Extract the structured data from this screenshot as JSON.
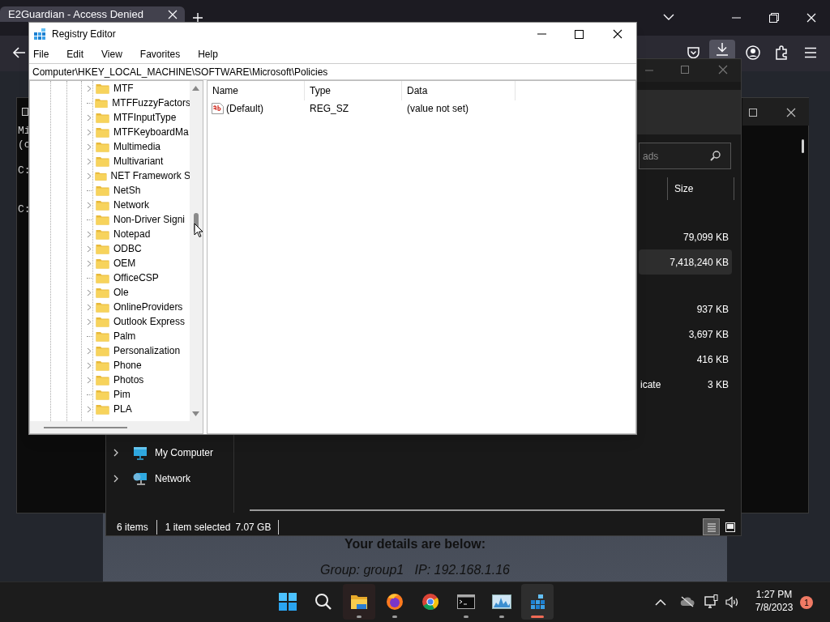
{
  "browser": {
    "tabs": [
      {
        "title": "E2Guardian - Access Denied",
        "selected": true
      }
    ],
    "page": {
      "heading": "Your details are below:",
      "details": "Group: group1   IP: 192.168.1.16"
    }
  },
  "terminal": {
    "lines": [
      "Mi",
      "(c",
      "C:",
      "C:"
    ]
  },
  "explorer": {
    "search": {
      "placeholder": "ads"
    },
    "columns": [
      "Size"
    ],
    "rows": [
      {
        "size": "79,099 KB",
        "selected": false
      },
      {
        "size": "7,418,240 KB",
        "selected": true
      },
      {
        "size": "937 KB",
        "selected": false
      },
      {
        "size": "3,697 KB",
        "selected": false
      },
      {
        "size": "416 KB",
        "selected": false
      },
      {
        "name": "icate",
        "size": "3 KB",
        "selected": false
      }
    ],
    "nav": [
      {
        "label": "My Computer",
        "kind": "computer",
        "expanded": false
      },
      {
        "label": "Network",
        "kind": "network",
        "expanded": false
      }
    ],
    "status_bar": {
      "count": "6 items",
      "selection": "1 item selected",
      "size": "7.07 GB"
    },
    "views": [
      {
        "kind": "details",
        "selected": true
      },
      {
        "kind": "tiles",
        "selected": false
      }
    ]
  },
  "regedit": {
    "window": {
      "title": "Registry Editor"
    },
    "menu": [
      "File",
      "Edit",
      "View",
      "Favorites",
      "Help"
    ],
    "address": "Computer\\HKEY_LOCAL_MACHINE\\SOFTWARE\\Microsoft\\Policies",
    "tree": [
      {
        "label": "MTF",
        "expandable": true
      },
      {
        "label": "MTFFuzzyFactors",
        "expandable": false
      },
      {
        "label": "MTFInputType",
        "expandable": true
      },
      {
        "label": "MTFKeyboardMa",
        "expandable": true
      },
      {
        "label": "Multimedia",
        "expandable": true
      },
      {
        "label": "Multivariant",
        "expandable": true
      },
      {
        "label": "NET Framework S",
        "expandable": true
      },
      {
        "label": "NetSh",
        "expandable": false
      },
      {
        "label": "Network",
        "expandable": true
      },
      {
        "label": "Non-Driver Signi",
        "expandable": false
      },
      {
        "label": "Notepad",
        "expandable": true
      },
      {
        "label": "ODBC",
        "expandable": true
      },
      {
        "label": "OEM",
        "expandable": true
      },
      {
        "label": "OfficeCSP",
        "expandable": false
      },
      {
        "label": "Ole",
        "expandable": true
      },
      {
        "label": "OnlineProviders",
        "expandable": true
      },
      {
        "label": "Outlook Express",
        "expandable": true
      },
      {
        "label": "Palm",
        "expandable": false
      },
      {
        "label": "Personalization",
        "expandable": true
      },
      {
        "label": "Phone",
        "expandable": true
      },
      {
        "label": "Photos",
        "expandable": true
      },
      {
        "label": "Pim",
        "expandable": false
      },
      {
        "label": "PLA",
        "expandable": true
      }
    ],
    "columns": [
      "Name",
      "Type",
      "Data"
    ],
    "values": [
      {
        "name": "(Default)",
        "type": "REG_SZ",
        "data": "(value not set)"
      }
    ]
  },
  "taskbar": {
    "apps": [
      {
        "kind": "start",
        "running": false,
        "active": false
      },
      {
        "kind": "search",
        "running": false,
        "active": false
      },
      {
        "kind": "files",
        "running": true,
        "active": false
      },
      {
        "kind": "browser1",
        "running": true,
        "active": false
      },
      {
        "kind": "browser2",
        "running": false,
        "active": false
      },
      {
        "kind": "terminal",
        "running": true,
        "active": false
      },
      {
        "kind": "monitor",
        "running": true,
        "active": false
      },
      {
        "kind": "registry",
        "running": true,
        "active": true
      }
    ],
    "time": "1:27 PM",
    "date": "7/8/2023",
    "notifications": "1"
  }
}
